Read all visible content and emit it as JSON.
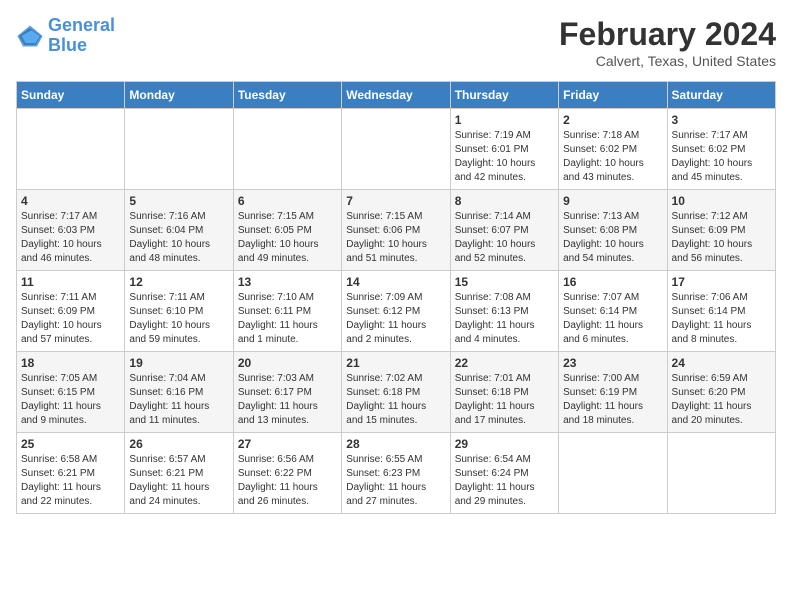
{
  "logo": {
    "line1": "General",
    "line2": "Blue"
  },
  "title": "February 2024",
  "subtitle": "Calvert, Texas, United States",
  "days_of_week": [
    "Sunday",
    "Monday",
    "Tuesday",
    "Wednesday",
    "Thursday",
    "Friday",
    "Saturday"
  ],
  "weeks": [
    [
      {
        "day": "",
        "info": ""
      },
      {
        "day": "",
        "info": ""
      },
      {
        "day": "",
        "info": ""
      },
      {
        "day": "",
        "info": ""
      },
      {
        "day": "1",
        "info": "Sunrise: 7:19 AM\nSunset: 6:01 PM\nDaylight: 10 hours\nand 42 minutes."
      },
      {
        "day": "2",
        "info": "Sunrise: 7:18 AM\nSunset: 6:02 PM\nDaylight: 10 hours\nand 43 minutes."
      },
      {
        "day": "3",
        "info": "Sunrise: 7:17 AM\nSunset: 6:02 PM\nDaylight: 10 hours\nand 45 minutes."
      }
    ],
    [
      {
        "day": "4",
        "info": "Sunrise: 7:17 AM\nSunset: 6:03 PM\nDaylight: 10 hours\nand 46 minutes."
      },
      {
        "day": "5",
        "info": "Sunrise: 7:16 AM\nSunset: 6:04 PM\nDaylight: 10 hours\nand 48 minutes."
      },
      {
        "day": "6",
        "info": "Sunrise: 7:15 AM\nSunset: 6:05 PM\nDaylight: 10 hours\nand 49 minutes."
      },
      {
        "day": "7",
        "info": "Sunrise: 7:15 AM\nSunset: 6:06 PM\nDaylight: 10 hours\nand 51 minutes."
      },
      {
        "day": "8",
        "info": "Sunrise: 7:14 AM\nSunset: 6:07 PM\nDaylight: 10 hours\nand 52 minutes."
      },
      {
        "day": "9",
        "info": "Sunrise: 7:13 AM\nSunset: 6:08 PM\nDaylight: 10 hours\nand 54 minutes."
      },
      {
        "day": "10",
        "info": "Sunrise: 7:12 AM\nSunset: 6:09 PM\nDaylight: 10 hours\nand 56 minutes."
      }
    ],
    [
      {
        "day": "11",
        "info": "Sunrise: 7:11 AM\nSunset: 6:09 PM\nDaylight: 10 hours\nand 57 minutes."
      },
      {
        "day": "12",
        "info": "Sunrise: 7:11 AM\nSunset: 6:10 PM\nDaylight: 10 hours\nand 59 minutes."
      },
      {
        "day": "13",
        "info": "Sunrise: 7:10 AM\nSunset: 6:11 PM\nDaylight: 11 hours\nand 1 minute."
      },
      {
        "day": "14",
        "info": "Sunrise: 7:09 AM\nSunset: 6:12 PM\nDaylight: 11 hours\nand 2 minutes."
      },
      {
        "day": "15",
        "info": "Sunrise: 7:08 AM\nSunset: 6:13 PM\nDaylight: 11 hours\nand 4 minutes."
      },
      {
        "day": "16",
        "info": "Sunrise: 7:07 AM\nSunset: 6:14 PM\nDaylight: 11 hours\nand 6 minutes."
      },
      {
        "day": "17",
        "info": "Sunrise: 7:06 AM\nSunset: 6:14 PM\nDaylight: 11 hours\nand 8 minutes."
      }
    ],
    [
      {
        "day": "18",
        "info": "Sunrise: 7:05 AM\nSunset: 6:15 PM\nDaylight: 11 hours\nand 9 minutes."
      },
      {
        "day": "19",
        "info": "Sunrise: 7:04 AM\nSunset: 6:16 PM\nDaylight: 11 hours\nand 11 minutes."
      },
      {
        "day": "20",
        "info": "Sunrise: 7:03 AM\nSunset: 6:17 PM\nDaylight: 11 hours\nand 13 minutes."
      },
      {
        "day": "21",
        "info": "Sunrise: 7:02 AM\nSunset: 6:18 PM\nDaylight: 11 hours\nand 15 minutes."
      },
      {
        "day": "22",
        "info": "Sunrise: 7:01 AM\nSunset: 6:18 PM\nDaylight: 11 hours\nand 17 minutes."
      },
      {
        "day": "23",
        "info": "Sunrise: 7:00 AM\nSunset: 6:19 PM\nDaylight: 11 hours\nand 18 minutes."
      },
      {
        "day": "24",
        "info": "Sunrise: 6:59 AM\nSunset: 6:20 PM\nDaylight: 11 hours\nand 20 minutes."
      }
    ],
    [
      {
        "day": "25",
        "info": "Sunrise: 6:58 AM\nSunset: 6:21 PM\nDaylight: 11 hours\nand 22 minutes."
      },
      {
        "day": "26",
        "info": "Sunrise: 6:57 AM\nSunset: 6:21 PM\nDaylight: 11 hours\nand 24 minutes."
      },
      {
        "day": "27",
        "info": "Sunrise: 6:56 AM\nSunset: 6:22 PM\nDaylight: 11 hours\nand 26 minutes."
      },
      {
        "day": "28",
        "info": "Sunrise: 6:55 AM\nSunset: 6:23 PM\nDaylight: 11 hours\nand 27 minutes."
      },
      {
        "day": "29",
        "info": "Sunrise: 6:54 AM\nSunset: 6:24 PM\nDaylight: 11 hours\nand 29 minutes."
      },
      {
        "day": "",
        "info": ""
      },
      {
        "day": "",
        "info": ""
      }
    ]
  ]
}
